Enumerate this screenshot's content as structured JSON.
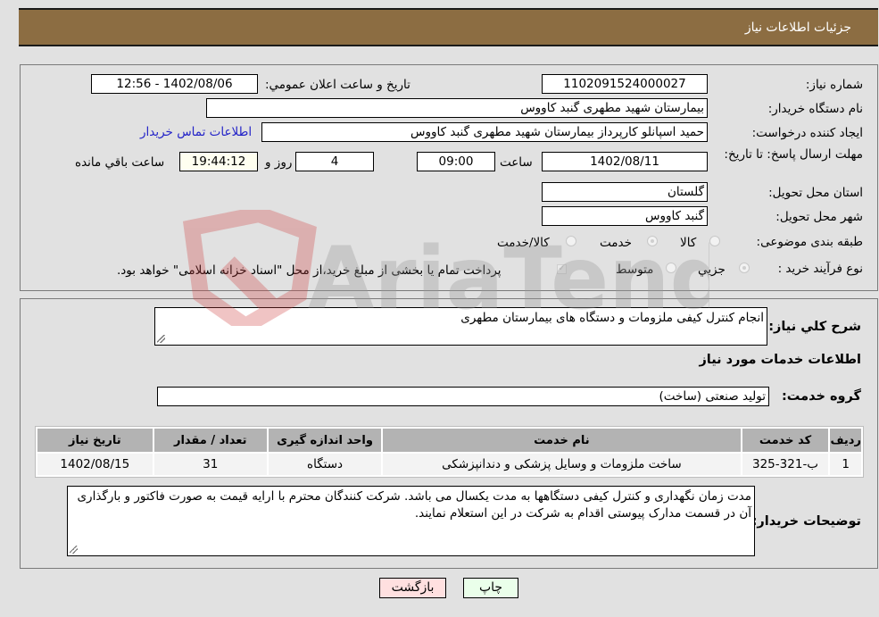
{
  "header": {
    "title": "جزئیات اطلاعات نیاز"
  },
  "form": {
    "need_number": {
      "label": "شماره نیاز:",
      "value": "1102091524000027"
    },
    "announce_datetime": {
      "label": "تاريخ و ساعت اعلان عمومي:",
      "value": "1402/08/06 - 12:56"
    },
    "buyer_org": {
      "label": "نام دستگاه خريدار:",
      "value": "بیمارستان شهید مطهری گنبد کاووس"
    },
    "requester": {
      "label": "ايجاد کننده درخواست:",
      "value": "حمید اسپانلو کارپرداز بیمارستان شهید مطهری گنبد کاووس"
    },
    "buyer_contact_link": "اطلاعات تماس خريدار",
    "deadline": {
      "label": "مهلت ارسال پاسخ: تا تاريخ:",
      "date": "1402/08/11",
      "time_label": "ساعت",
      "time": "09:00",
      "days": "4",
      "days_label": "روز و",
      "remaining": "19:44:12",
      "remaining_label": "ساعت باقي مانده"
    },
    "province": {
      "label": "استان محل تحويل:",
      "value": "گلستان"
    },
    "city": {
      "label": "شهر محل تحويل:",
      "value": "گنبد کاووس"
    },
    "category": {
      "label": "طبقه بندی موضوعی:",
      "options": [
        "کالا",
        "خدمت",
        "کالا/خدمت"
      ],
      "selected": "خدمت"
    },
    "purchase_type": {
      "label": "نوع فرآيند خريد :",
      "options": [
        "جزيي",
        "متوسط"
      ],
      "selected": "جزيي",
      "treasury_note": "پرداخت تمام يا بخشی از مبلغ خريد،از محل \"اسناد خزانه اسلامی\" خواهد بود."
    }
  },
  "description": {
    "label": "شرح کلي نياز:",
    "value": "انجام کنترل کیفی ملزومات و دستگاه های بیمارستان مطهری"
  },
  "services": {
    "section_title": "اطلاعات خدمات مورد نياز",
    "group_label": "گروه خدمت:",
    "group_value": "تولید صنعتی (ساخت)",
    "table": {
      "headers": [
        "رديف",
        "کد خدمت",
        "نام خدمت",
        "واحد اندازه گيری",
        "تعداد / مقدار",
        "تاريخ نياز"
      ],
      "rows": [
        [
          "1",
          "ب-321-325",
          "ساخت ملزومات و وسایل پزشکی و دندانپزشکی",
          "دستگاه",
          "31",
          "1402/08/15"
        ]
      ]
    }
  },
  "buyer_notes": {
    "label": "توضيحات خريدار:",
    "value": "مدت زمان نگهداری و کنترل کیفی دستگاهها به مدت یکسال می باشد. شرکت کنندگان محترم با ارایه قیمت به صورت فاکتور و بارگذاری آن در قسمت مدارک پیوستی اقدام به شرکت در این استعلام نمایند."
  },
  "buttons": {
    "print": "چاپ",
    "back": "بازگشت"
  },
  "watermark": {
    "text": "AriaTender.neT"
  },
  "colors": {
    "header_bg": "#8c6d42",
    "print_bg": "#eaffea",
    "back_bg": "#ffe0e0",
    "link": "#2323c8"
  }
}
